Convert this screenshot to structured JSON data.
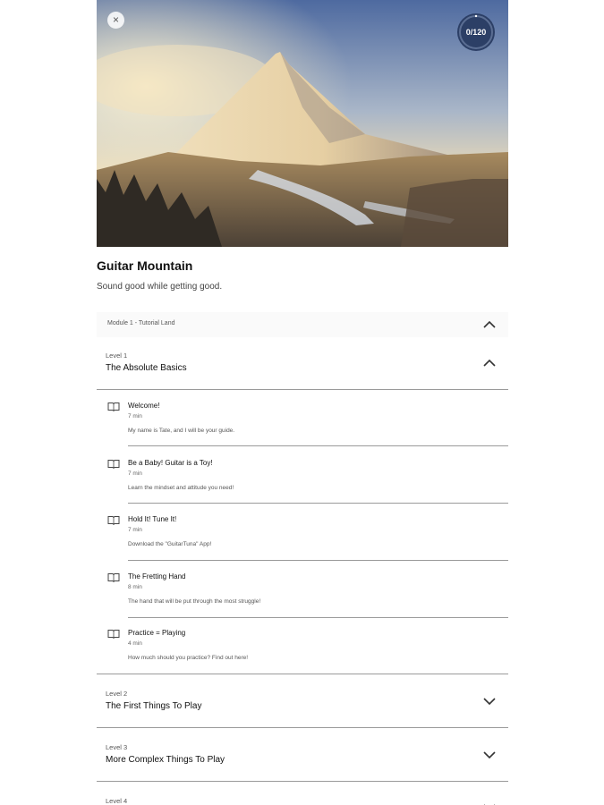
{
  "header": {
    "close_icon": "×",
    "progress_text": "0/120",
    "progress_fraction": 0
  },
  "course": {
    "title": "Guitar Mountain",
    "subtitle": "Sound good while getting good."
  },
  "module": {
    "label": "Module 1 - Tutorial Land"
  },
  "levels": [
    {
      "num": "Level 1",
      "name": "The Absolute Basics"
    },
    {
      "num": "Level 2",
      "name": "The First Things To Play"
    },
    {
      "num": "Level 3",
      "name": "More Complex Things To Play"
    },
    {
      "num": "Level 4",
      "name": ""
    }
  ],
  "lessons": [
    {
      "title": "Welcome!",
      "duration": "7 min",
      "desc": "My name is Tate, and I will be your guide."
    },
    {
      "title": "Be a Baby! Guitar is a Toy!",
      "duration": "7 min",
      "desc": "Learn the mindset and attitude you need!"
    },
    {
      "title": "Hold It! Tune It!",
      "duration": "7 min",
      "desc": "Download the \"GuitarTuna\" App!"
    },
    {
      "title": "The Fretting Hand",
      "duration": "8 min",
      "desc": "The hand that will be put through the most struggle!"
    },
    {
      "title": "Practice = Playing",
      "duration": "4 min",
      "desc": "How much should you practice? Find out here!"
    }
  ],
  "colors": {
    "progress_ring_bg": "#2c3f66",
    "divider": "#9a9a9a",
    "chevron": "#333333"
  }
}
